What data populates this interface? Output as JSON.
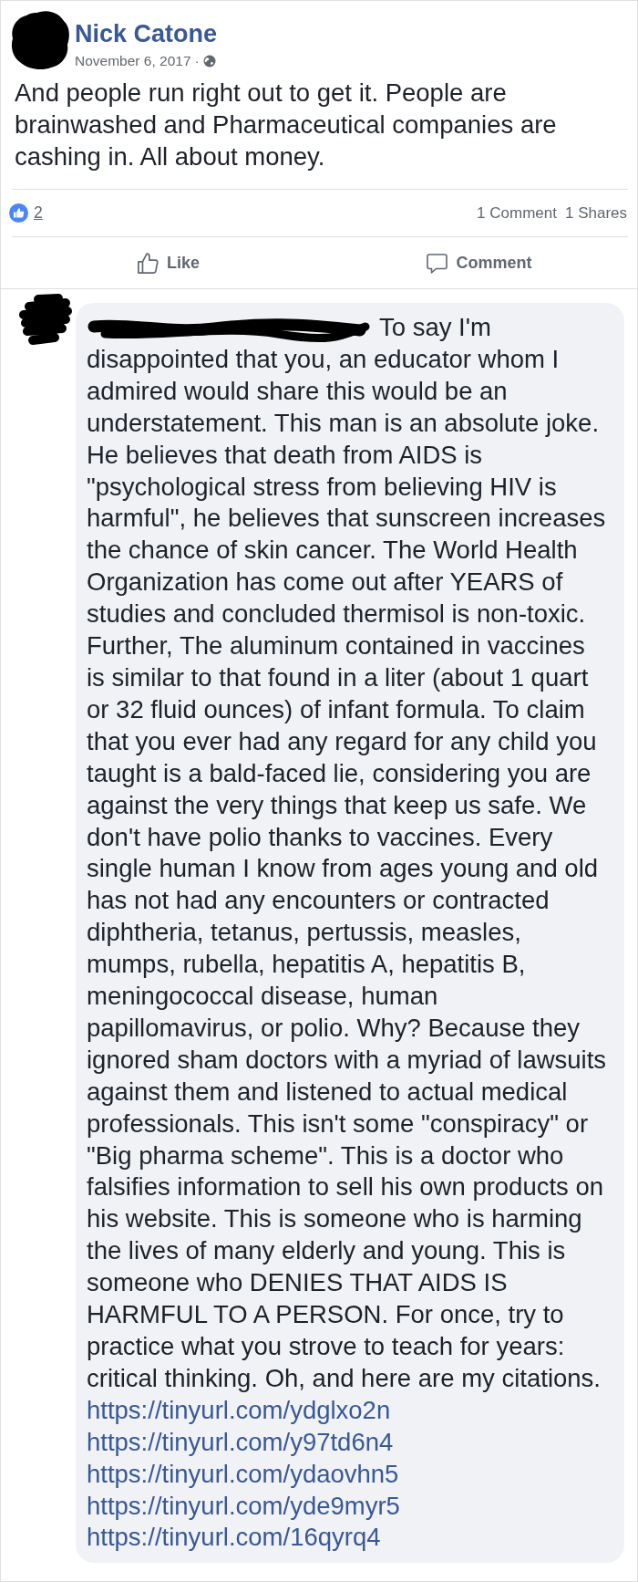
{
  "post": {
    "author": "Nick Catone",
    "date": "November 6, 2017",
    "separator": "·",
    "text": "And people run right out to get it. People are brainwashed and Pharmaceutical companies are cashing in. All about money."
  },
  "reactions": {
    "count": "2",
    "comments": "1 Comment",
    "shares": "1 Shares"
  },
  "actions": [
    {
      "kind": "like",
      "label": "Like"
    },
    {
      "kind": "comment",
      "label": "Comment"
    }
  ],
  "comments": [
    {
      "text": "To say I'm disappointed that you, an educator whom I admired would share this would be an understatement. This man is an absolute joke. He believes that death from AIDS is \"psychological stress from believing HIV is harmful\", he believes that sunscreen increases the chance of skin cancer. The World Health Organization has come out after YEARS of studies and concluded thermisol is non-toxic. Further, The aluminum contained in vaccines is similar to that found in a liter (about 1 quart or 32 fluid ounces) of infant formula. To claim that you ever had any regard for any child you taught is a bald-faced lie, considering you are against the very things that keep us safe. We don't have polio thanks to vaccines. Every single human I know from ages young and old has not had any encounters or contracted diphtheria, tetanus, pertussis, measles, mumps, rubella, hepatitis A, hepatitis B, meningococcal disease, human papillomavirus, or polio. Why? Because they ignored sham doctors with a myriad of lawsuits against them and listened to actual medical professionals. This isn't some \"conspiracy\" or \"Big pharma scheme\". This is a doctor who falsifies information to sell his own products on his website. This is someone who is harming the lives of many elderly and young. This is someone who DENIES THAT AIDS IS HARMFUL TO A PERSON. For once, try to practice what you strove to teach for years: critical thinking. Oh, and here are my citations.",
      "links": [
        "https://tinyurl.com/ydglxo2n",
        "https://tinyurl.com/y97td6n4",
        "https://tinyurl.com/ydaovhn5",
        "https://tinyurl.com/yde9myr5",
        "https://tinyurl.com/16qyrq4"
      ]
    }
  ]
}
